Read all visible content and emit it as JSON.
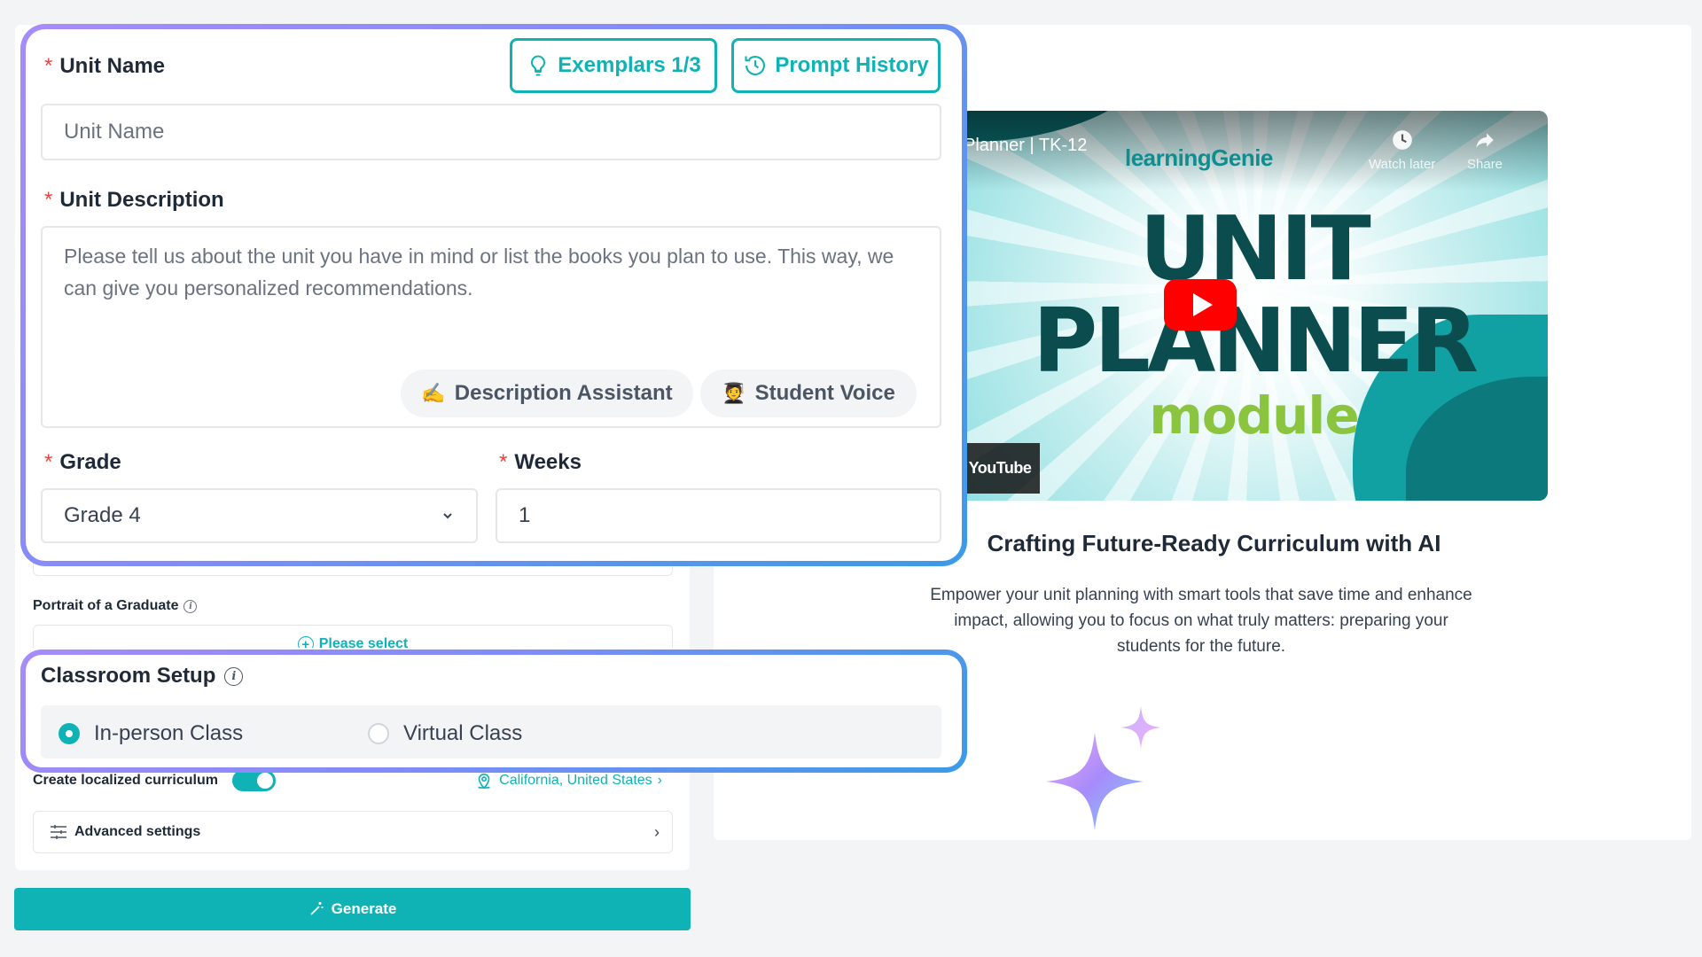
{
  "unit_form": {
    "unit_name": {
      "label": "Unit Name",
      "required_marker": "*",
      "placeholder": "Unit Name",
      "value": ""
    },
    "exemplars_button": {
      "label": "Exemplars 1/3",
      "icon": "lightbulb-icon"
    },
    "prompt_history_button": {
      "label": "Prompt History",
      "icon": "history-icon"
    },
    "unit_description": {
      "label": "Unit Description",
      "required_marker": "*",
      "placeholder": "Please tell us about the unit you have in mind or list the books you plan to use. This way, we can give you personalized recommendations.",
      "value": ""
    },
    "description_assistant": {
      "label": "Description Assistant",
      "emoji": "✍️"
    },
    "student_voice": {
      "label": "Student Voice",
      "emoji": "🧑‍🎓"
    },
    "grade": {
      "label": "Grade",
      "required_marker": "*",
      "value": "Grade 4"
    },
    "weeks": {
      "label": "Weeks",
      "required_marker": "*",
      "value": "1"
    }
  },
  "portrait_of_graduate": {
    "label": "Portrait of a Graduate",
    "select_label": "Please select"
  },
  "classroom_setup": {
    "title": "Classroom Setup",
    "options": [
      {
        "label": "In-person Class",
        "selected": true
      },
      {
        "label": "Virtual Class",
        "selected": false
      }
    ]
  },
  "localized": {
    "label": "Create localized curriculum",
    "enabled": true,
    "location": "California, United States"
  },
  "advanced_settings": {
    "label": "Advanced settings"
  },
  "generate_button": {
    "label": "Generate"
  },
  "video": {
    "title": "Planner | TK-12",
    "brand": "learningGenie",
    "line1": "UNIT",
    "line2": "PLANNER",
    "line3": "module",
    "watch_later": "Watch later",
    "share": "Share",
    "youtube_badge": "YouTube"
  },
  "intro": {
    "heading": "Crafting Future-Ready Curriculum with AI",
    "body": "Empower your unit planning with smart tools that save time and enhance impact, allowing you to focus on what truly matters: preparing your students for the future."
  },
  "colors": {
    "accent": "#10b3b5",
    "required": "#ef4444",
    "highlight_start": "#a78bfa",
    "highlight_end": "#3b9be8"
  }
}
